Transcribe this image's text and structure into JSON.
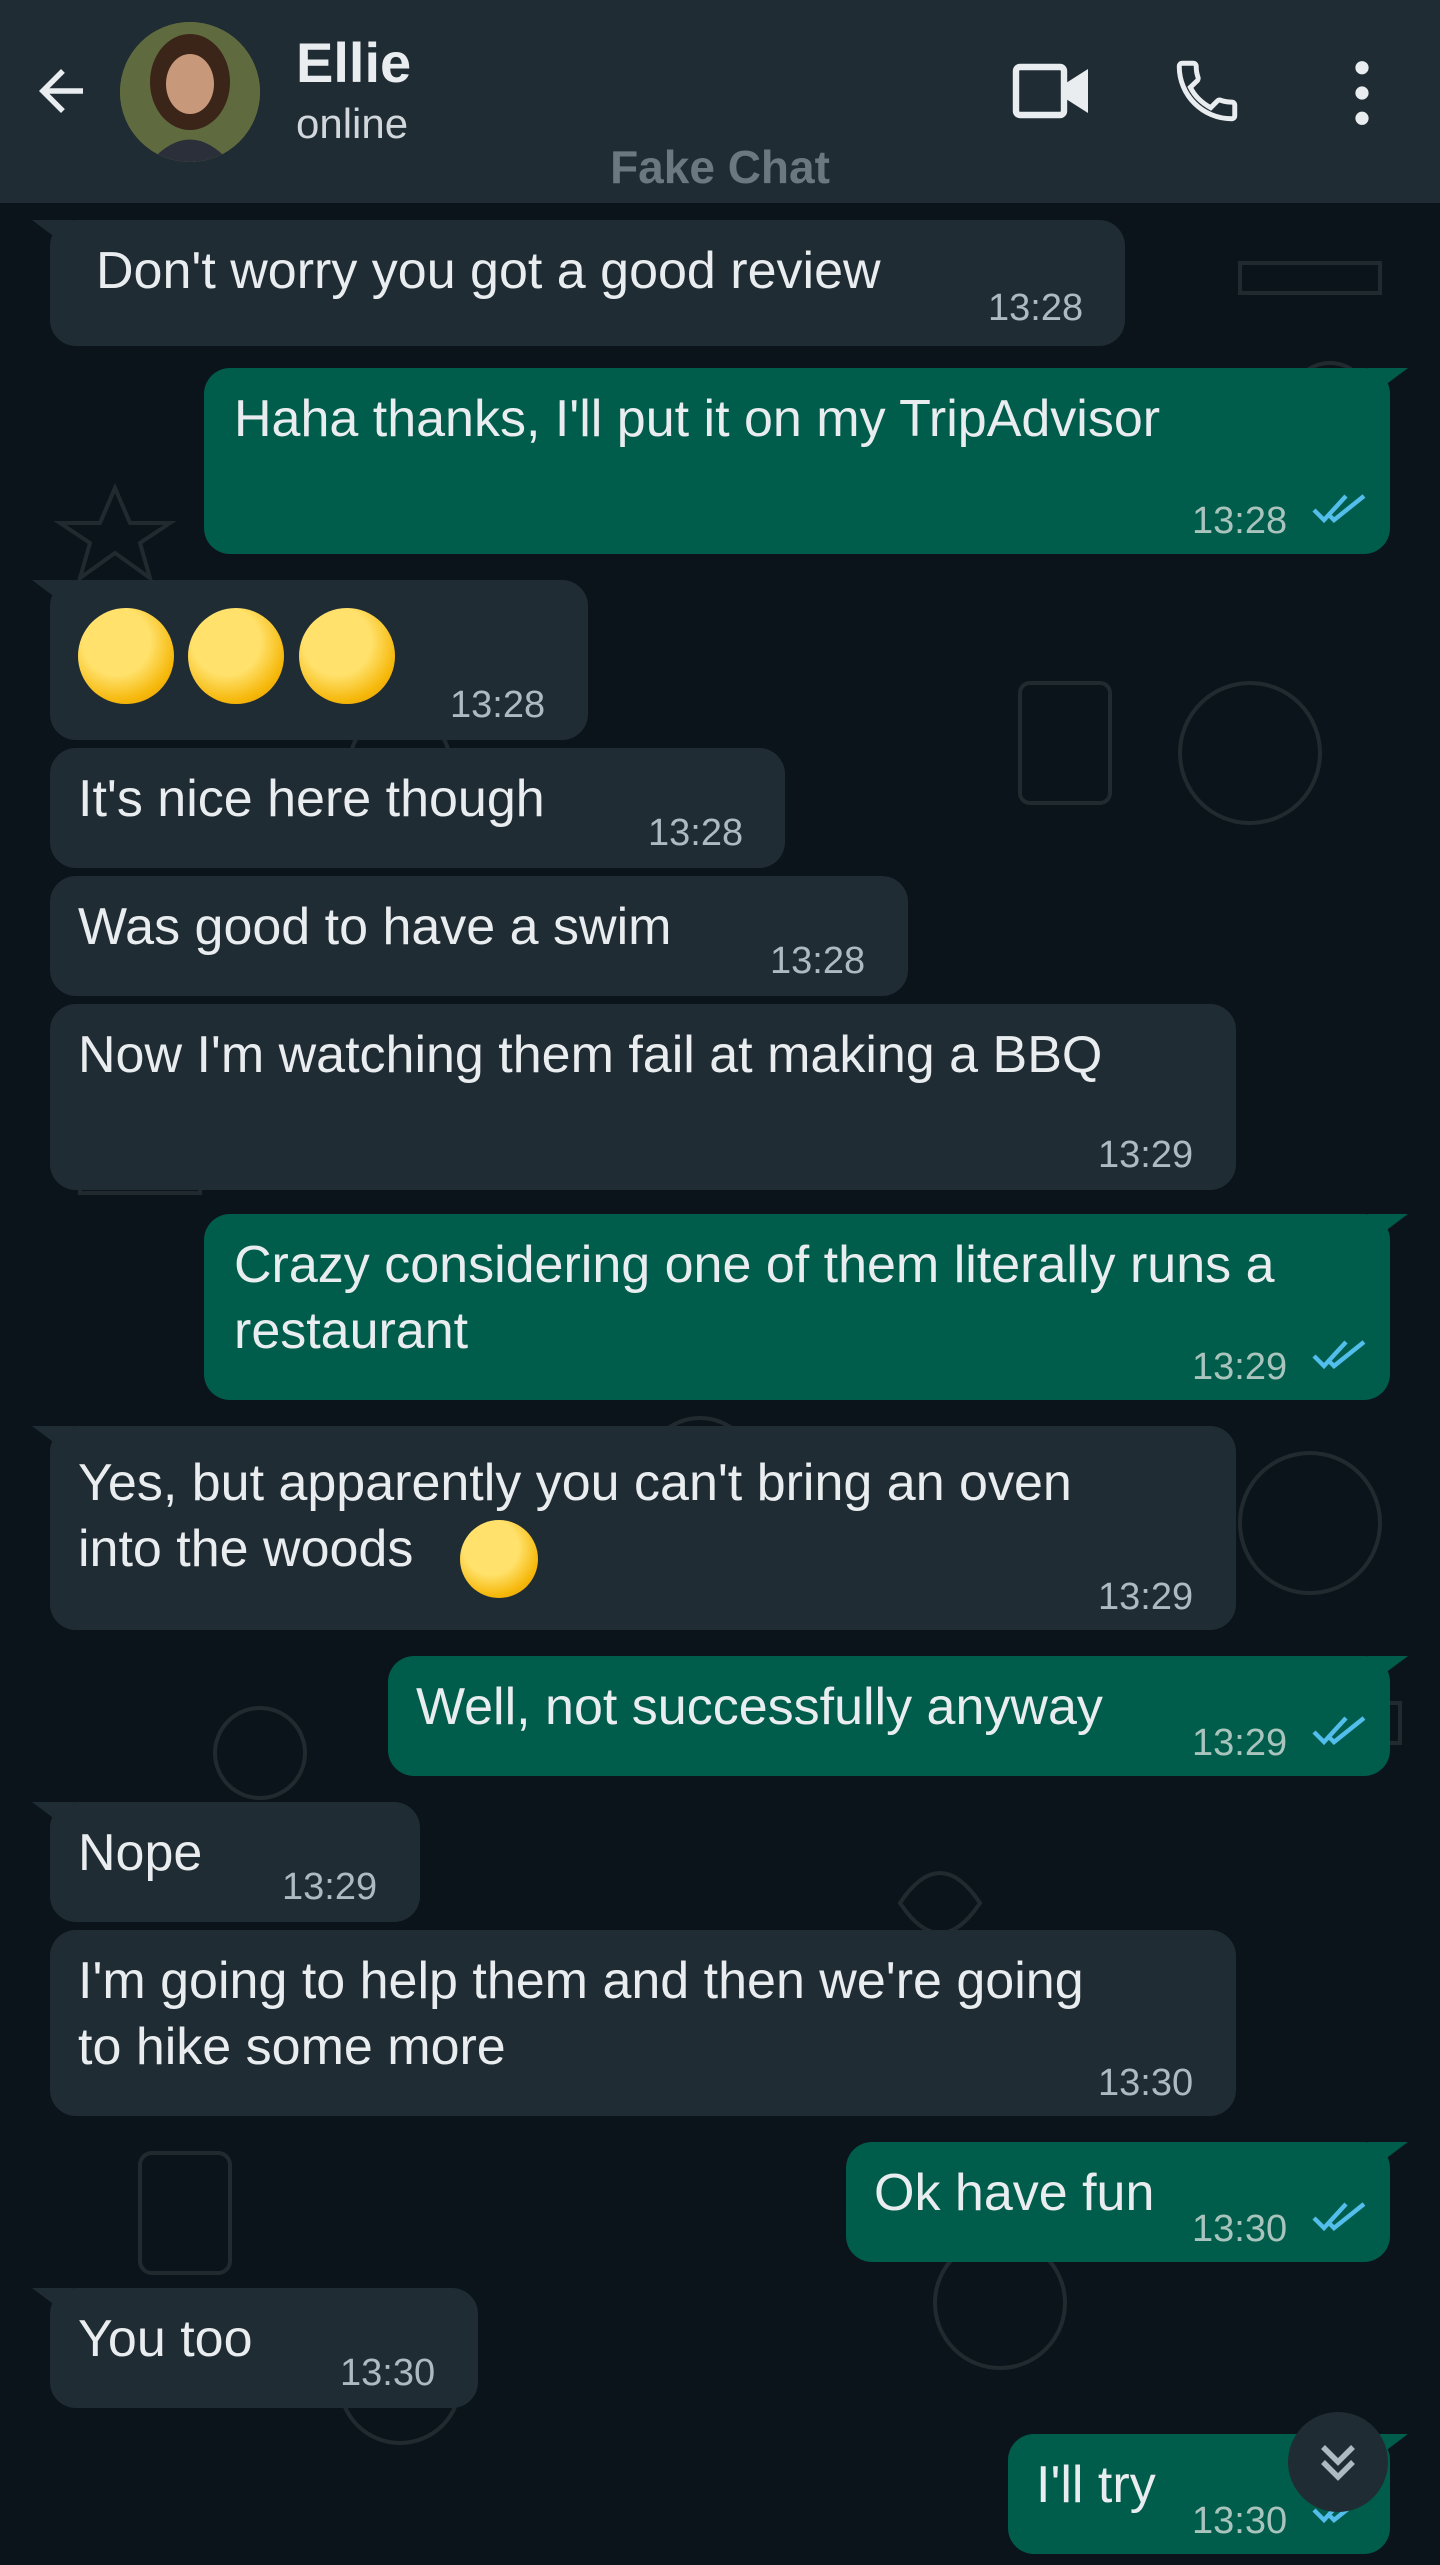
{
  "header": {
    "contact_name": "Ellie",
    "status": "online",
    "watermark": "Fake Chat",
    "icons": [
      "back-arrow-icon",
      "video-call-icon",
      "voice-call-icon",
      "more-options-icon"
    ]
  },
  "colors": {
    "header_bg": "#1f2c34",
    "chat_bg": "#0b141a",
    "incoming_bubble": "#202c33",
    "outgoing_bubble": "#005c4b",
    "read_tick": "#53bdeb"
  },
  "messages": [
    {
      "dir": "in",
      "text": "Don't worry you got a good review",
      "time": "13:28"
    },
    {
      "dir": "out",
      "text": "Haha thanks, I'll put it on my TripAdvisor",
      "time": "13:28",
      "read": true
    },
    {
      "dir": "in",
      "text": "",
      "emoji": "rolling-on-floor-laughing x3",
      "time": "13:28"
    },
    {
      "dir": "in",
      "text": "It's nice here though",
      "time": "13:28"
    },
    {
      "dir": "in",
      "text": "Was good to have a swim",
      "time": "13:28"
    },
    {
      "dir": "in",
      "text": "Now I'm watching them fail at making a BBQ",
      "time": "13:29"
    },
    {
      "dir": "out",
      "text": "Crazy considering one of them literally runs a\nrestaurant",
      "time": "13:29",
      "read": true
    },
    {
      "dir": "in",
      "text": "Yes, but apparently you can't bring an oven\ninto the woods",
      "emoji": "rolling-on-floor-laughing",
      "time": "13:29"
    },
    {
      "dir": "out",
      "text": "Well, not successfully anyway",
      "time": "13:29",
      "read": true
    },
    {
      "dir": "in",
      "text": "Nope",
      "time": "13:29"
    },
    {
      "dir": "in",
      "text": "I'm going to help them and then we're going\nto hike some more",
      "time": "13:30"
    },
    {
      "dir": "out",
      "text": "Ok have fun",
      "time": "13:30",
      "read": true
    },
    {
      "dir": "in",
      "text": "You too",
      "time": "13:30"
    },
    {
      "dir": "out",
      "text": "I'll try",
      "time": "13:30",
      "read": true
    }
  ]
}
